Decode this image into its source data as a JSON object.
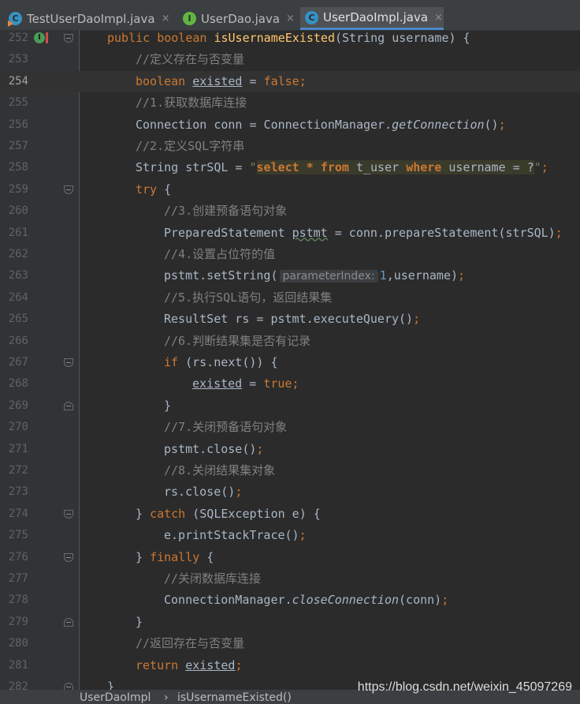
{
  "tabs": [
    {
      "label": "TestUserDaoImpl.java",
      "icon": "class-run-icon",
      "close": "×"
    },
    {
      "label": "UserDao.java",
      "icon": "interface-icon",
      "close": "×"
    },
    {
      "label": "UserDaoImpl.java",
      "icon": "class-icon",
      "close": "×",
      "active": true
    }
  ],
  "icon_letters": {
    "class": "C",
    "interface": "I"
  },
  "gutter": {
    "line_numbers": [
      "252",
      "253",
      "254",
      "255",
      "256",
      "257",
      "258",
      "259",
      "260",
      "261",
      "262",
      "263",
      "264",
      "265",
      "266",
      "267",
      "268",
      "269",
      "270",
      "271",
      "272",
      "273",
      "274",
      "275",
      "276",
      "277",
      "278",
      "279",
      "280",
      "281",
      "282"
    ],
    "current_line": "254",
    "override_marker": "I"
  },
  "code": {
    "l252": {
      "kw1": "public",
      "kw2": "boolean",
      "method": "isUsernameExisted",
      "rest": "(String username) {"
    },
    "l253": {
      "comment": "//定义存在与否变量"
    },
    "l254": {
      "kw": "boolean",
      "var": "existed",
      "eq": " = ",
      "val": "false",
      "semi": ";"
    },
    "l255": {
      "comment": "//1.获取数据库连接"
    },
    "l256": {
      "pre": "Connection conn = ConnectionManager.",
      "call": "getConnection",
      "post": "()",
      "semi": ";"
    },
    "l257": {
      "comment": "//2.定义SQL字符串"
    },
    "l258": {
      "pre": "String strSQL = ",
      "q1": "\"",
      "sel": "select",
      "star": " * ",
      "from": "from",
      "tbl": " t_user ",
      "where": "where",
      "cond": " username = ?",
      "q2": "\"",
      "semi": ";"
    },
    "l259": {
      "kw": "try",
      "rest": " {"
    },
    "l260": {
      "comment": "//3.创建预备语句对象"
    },
    "l261": {
      "pre": "PreparedStatement ",
      "var": "pstmt",
      "post": " = conn.prepareStatement(strSQL)",
      "semi": ";"
    },
    "l262": {
      "comment": "//4.设置占位符的值"
    },
    "l263": {
      "pre": "pstmt.setString(",
      "hint": "parameterIndex:",
      "num": "1",
      "post": ",username)",
      "semi": ";"
    },
    "l264": {
      "comment": "//5.执行SQL语句，返回结果集"
    },
    "l265": {
      "pre": "ResultSet rs = pstmt.executeQuery()",
      "semi": ";"
    },
    "l266": {
      "comment": "//6.判断结果集是否有记录"
    },
    "l267": {
      "kw": "if",
      "rest": " (rs.next()) {"
    },
    "l268": {
      "var": "existed",
      "eq": " = ",
      "val": "true",
      "semi": ";"
    },
    "l269": {
      "text": "}"
    },
    "l270": {
      "comment": "//7.关闭预备语句对象"
    },
    "l271": {
      "pre": "pstmt.close()",
      "semi": ";"
    },
    "l272": {
      "comment": "//8.关闭结果集对象"
    },
    "l273": {
      "pre": "rs.close()",
      "semi": ";"
    },
    "l274": {
      "pre": "} ",
      "kw": "catch",
      "rest": " (SQLException e) {"
    },
    "l275": {
      "pre": "e.printStackTrace()",
      "semi": ";"
    },
    "l276": {
      "pre": "} ",
      "kw": "finally",
      "rest": " {"
    },
    "l277": {
      "comment": "//关闭数据库连接"
    },
    "l278": {
      "pre": "ConnectionManager.",
      "call": "closeConnection",
      "post": "(conn)",
      "semi": ";"
    },
    "l279": {
      "text": "}"
    },
    "l280": {
      "comment": "//返回存在与否变量"
    },
    "l281": {
      "kw": "return",
      "sp": " ",
      "var": "existed",
      "semi": ";"
    },
    "l282": {
      "text": "}"
    }
  },
  "breadcrumb": {
    "class": "UserDaoImpl",
    "sep": "›",
    "method": "isUsernameExisted()"
  },
  "watermark": "https://blog.csdn.net/weixin_45097269",
  "colors": {
    "background": "#2b2b2b",
    "keyword": "#cc7832",
    "comment": "#808080",
    "method": "#ffc66d",
    "string": "#6a8759",
    "number": "#6897bb",
    "accent": "#4a88c7"
  }
}
